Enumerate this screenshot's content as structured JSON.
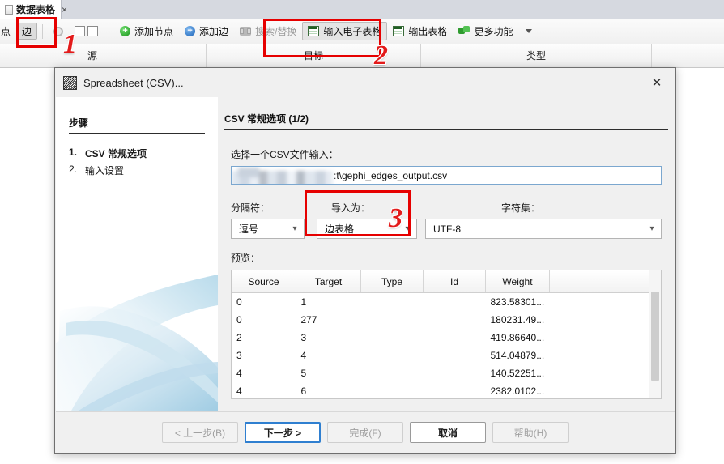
{
  "app": {
    "tab": {
      "label": "数据表格",
      "close": "×"
    },
    "toolbar": {
      "node_toggle": "点",
      "edge_toggle": "边",
      "gear_icon": "gear-icon",
      "columns_icon": "two-columns-icon",
      "buttons": [
        {
          "label": "添加节点",
          "icon": "plus-green-icon",
          "disabled": false,
          "pressed": false
        },
        {
          "label": "添加边",
          "icon": "plus-blue-icon",
          "disabled": false,
          "pressed": false
        },
        {
          "label": "搜索/替换",
          "icon": "binoculars-icon",
          "disabled": true,
          "pressed": false
        },
        {
          "label": "输入电子表格",
          "icon": "spreadsheet-icon",
          "disabled": false,
          "pressed": true
        },
        {
          "label": "输出表格",
          "icon": "spreadsheet-icon",
          "disabled": false,
          "pressed": false
        },
        {
          "label": "更多功能",
          "icon": "puzzle-icon",
          "disabled": false,
          "pressed": false
        }
      ],
      "overflow_icon": "chevron-down-icon"
    },
    "table_headers": [
      "源",
      "目标",
      "类型"
    ]
  },
  "dialog": {
    "title": "Spreadsheet (CSV)...",
    "logo_icon": "gephi-logo-icon",
    "close_icon": "close-icon",
    "steps": {
      "heading": "步骤",
      "items": [
        {
          "num": "1.",
          "label": "CSV 常规选项",
          "active": true
        },
        {
          "num": "2.",
          "label": "输入设置",
          "active": false
        }
      ]
    },
    "pane": {
      "title": "CSV 常规选项 (1/2)",
      "file": {
        "label": "选择一个CSV文件输入：",
        "value": ":t\\gephi_edges_output.csv",
        "redacted": true
      },
      "separator": {
        "label": "分隔符：",
        "value": "逗号",
        "arrow": "⌄"
      },
      "import_as": {
        "label": "导入为：",
        "value": "边表格",
        "arrow": "⌄"
      },
      "charset": {
        "label": "字符集：",
        "value": "UTF-8",
        "arrow": "⌄"
      },
      "preview": {
        "label": "预览：",
        "columns": [
          "Source",
          "Target",
          "Type",
          "Id",
          "Weight",
          ""
        ],
        "rows": [
          [
            "0",
            "1",
            "",
            "",
            "823.58301...",
            ""
          ],
          [
            "0",
            "277",
            "",
            "",
            "180231.49...",
            ""
          ],
          [
            "2",
            "3",
            "",
            "",
            "419.86640...",
            ""
          ],
          [
            "3",
            "4",
            "",
            "",
            "514.04879...",
            ""
          ],
          [
            "4",
            "5",
            "",
            "",
            "140.52251...",
            ""
          ],
          [
            "4",
            "6",
            "",
            "",
            "2382.0102...",
            ""
          ]
        ]
      }
    },
    "footer": {
      "back": {
        "label": "< 上一步(B)",
        "disabled": true,
        "default": false
      },
      "next": {
        "label": "下一步 >",
        "disabled": false,
        "default": true
      },
      "finish": {
        "label": "完成(F)",
        "disabled": true,
        "default": false
      },
      "cancel": {
        "label": "取消",
        "disabled": false,
        "default": false
      },
      "help": {
        "label": "帮助(H)",
        "disabled": true,
        "default": false
      }
    }
  },
  "annotations": {
    "accent_color": "#e31b1b",
    "markers": [
      {
        "number": "1",
        "target": "edge-toggle-button"
      },
      {
        "number": "2",
        "target": "import-spreadsheet-button"
      },
      {
        "number": "3",
        "target": "import-as-combo"
      }
    ]
  }
}
